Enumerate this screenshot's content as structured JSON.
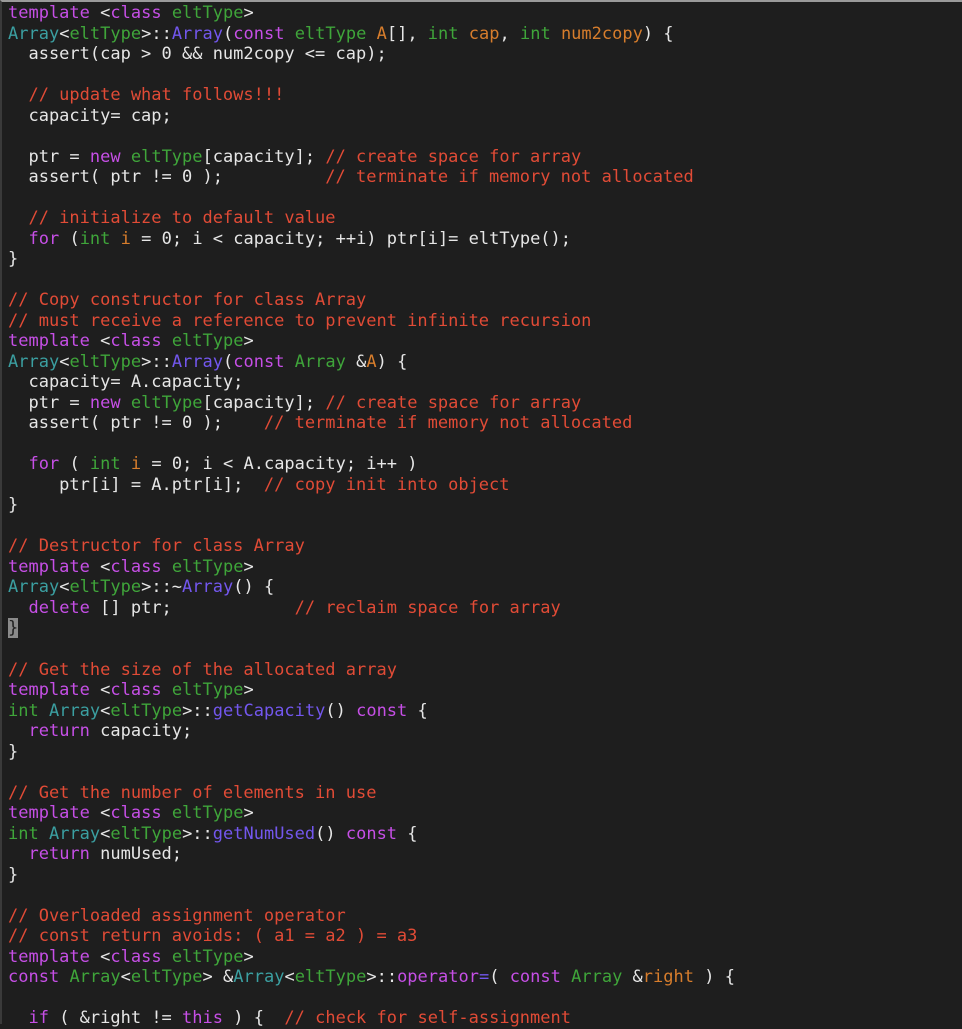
{
  "colors": {
    "background": "#1e1e1e",
    "plain": "#e6e6e6",
    "keyword": "#c64fe6",
    "type": "#3fa53a",
    "class": "#3b9fa1",
    "function": "#7357ee",
    "comment": "#e14b36",
    "parameter": "#d77d2c"
  },
  "cursor_line": 31,
  "lines": [
    [
      [
        "kw",
        "template"
      ],
      [
        "pl",
        " <"
      ],
      [
        "kw",
        "class"
      ],
      [
        "pl",
        " "
      ],
      [
        "ty",
        "eltType"
      ],
      [
        "pl",
        ">"
      ]
    ],
    [
      [
        "cls",
        "Array"
      ],
      [
        "pl",
        "<"
      ],
      [
        "ty",
        "eltType"
      ],
      [
        "pl",
        ">::"
      ],
      [
        "fn",
        "Array"
      ],
      [
        "pl",
        "("
      ],
      [
        "kw",
        "const"
      ],
      [
        "pl",
        " "
      ],
      [
        "ty",
        "eltType"
      ],
      [
        "pl",
        " "
      ],
      [
        "par",
        "A"
      ],
      [
        "pl",
        "[], "
      ],
      [
        "ty",
        "int"
      ],
      [
        "pl",
        " "
      ],
      [
        "par",
        "cap"
      ],
      [
        "pl",
        ", "
      ],
      [
        "ty",
        "int"
      ],
      [
        "pl",
        " "
      ],
      [
        "par",
        "num2copy"
      ],
      [
        "pl",
        ") {"
      ]
    ],
    [
      [
        "pl",
        "  assert(cap > 0 && num2copy <= cap);"
      ]
    ],
    [],
    [
      [
        "cm",
        "  // update what follows!!!"
      ]
    ],
    [
      [
        "pl",
        "  capacity= cap;"
      ]
    ],
    [],
    [
      [
        "pl",
        "  ptr = "
      ],
      [
        "kw",
        "new"
      ],
      [
        "pl",
        " "
      ],
      [
        "ty",
        "eltType"
      ],
      [
        "pl",
        "[capacity]; "
      ],
      [
        "cm",
        "// create space for array"
      ]
    ],
    [
      [
        "pl",
        "  assert( ptr != 0 );          "
      ],
      [
        "cm",
        "// terminate if memory not allocated"
      ]
    ],
    [],
    [
      [
        "cm",
        "  // initialize to default value"
      ]
    ],
    [
      [
        "pl",
        "  "
      ],
      [
        "kw",
        "for"
      ],
      [
        "pl",
        " ("
      ],
      [
        "ty",
        "int"
      ],
      [
        "pl",
        " "
      ],
      [
        "par",
        "i"
      ],
      [
        "pl",
        " = 0; i < capacity; ++i) ptr[i]= eltType();"
      ]
    ],
    [
      [
        "pl",
        "}"
      ]
    ],
    [],
    [
      [
        "cm",
        "// Copy constructor for class Array"
      ]
    ],
    [
      [
        "cm",
        "// must receive a reference to prevent infinite recursion"
      ]
    ],
    [
      [
        "kw",
        "template"
      ],
      [
        "pl",
        " <"
      ],
      [
        "kw",
        "class"
      ],
      [
        "pl",
        " "
      ],
      [
        "ty",
        "eltType"
      ],
      [
        "pl",
        ">"
      ]
    ],
    [
      [
        "cls",
        "Array"
      ],
      [
        "pl",
        "<"
      ],
      [
        "ty",
        "eltType"
      ],
      [
        "pl",
        ">::"
      ],
      [
        "fn",
        "Array"
      ],
      [
        "pl",
        "("
      ],
      [
        "kw",
        "const"
      ],
      [
        "pl",
        " "
      ],
      [
        "ty",
        "Array"
      ],
      [
        "pl",
        " &"
      ],
      [
        "par",
        "A"
      ],
      [
        "pl",
        ") {"
      ]
    ],
    [
      [
        "pl",
        "  capacity= A.capacity;"
      ]
    ],
    [
      [
        "pl",
        "  ptr = "
      ],
      [
        "kw",
        "new"
      ],
      [
        "pl",
        " "
      ],
      [
        "ty",
        "eltType"
      ],
      [
        "pl",
        "[capacity]; "
      ],
      [
        "cm",
        "// create space for array"
      ]
    ],
    [
      [
        "pl",
        "  assert( ptr != 0 );    "
      ],
      [
        "cm",
        "// terminate if memory not allocated"
      ]
    ],
    [],
    [
      [
        "pl",
        "  "
      ],
      [
        "kw",
        "for"
      ],
      [
        "pl",
        " ( "
      ],
      [
        "ty",
        "int"
      ],
      [
        "pl",
        " "
      ],
      [
        "par",
        "i"
      ],
      [
        "pl",
        " = 0; i < A.capacity; i++ )"
      ]
    ],
    [
      [
        "pl",
        "     ptr[i] = A.ptr[i];  "
      ],
      [
        "cm",
        "// copy init into object"
      ]
    ],
    [
      [
        "pl",
        "}"
      ]
    ],
    [],
    [
      [
        "cm",
        "// Destructor for class Array"
      ]
    ],
    [
      [
        "kw",
        "template"
      ],
      [
        "pl",
        " <"
      ],
      [
        "kw",
        "class"
      ],
      [
        "pl",
        " "
      ],
      [
        "ty",
        "eltType"
      ],
      [
        "pl",
        ">"
      ]
    ],
    [
      [
        "cls",
        "Array"
      ],
      [
        "pl",
        "<"
      ],
      [
        "ty",
        "eltType"
      ],
      [
        "pl",
        ">::~"
      ],
      [
        "fn",
        "Array"
      ],
      [
        "pl",
        "() {"
      ]
    ],
    [
      [
        "pl",
        "  "
      ],
      [
        "kw",
        "delete"
      ],
      [
        "pl",
        " [] ptr;            "
      ],
      [
        "cm",
        "// reclaim space for array"
      ]
    ],
    [
      [
        "pl",
        "}"
      ]
    ],
    [],
    [
      [
        "cm",
        "// Get the size of the allocated array"
      ]
    ],
    [
      [
        "kw",
        "template"
      ],
      [
        "pl",
        " <"
      ],
      [
        "kw",
        "class"
      ],
      [
        "pl",
        " "
      ],
      [
        "ty",
        "eltType"
      ],
      [
        "pl",
        ">"
      ]
    ],
    [
      [
        "ty",
        "int"
      ],
      [
        "pl",
        " "
      ],
      [
        "cls",
        "Array"
      ],
      [
        "pl",
        "<"
      ],
      [
        "ty",
        "eltType"
      ],
      [
        "pl",
        ">::"
      ],
      [
        "fn",
        "getCapacity"
      ],
      [
        "pl",
        "() "
      ],
      [
        "kw",
        "const"
      ],
      [
        "pl",
        " {"
      ]
    ],
    [
      [
        "pl",
        "  "
      ],
      [
        "kw",
        "return"
      ],
      [
        "pl",
        " capacity;"
      ]
    ],
    [
      [
        "pl",
        "}"
      ]
    ],
    [],
    [
      [
        "cm",
        "// Get the number of elements in use"
      ]
    ],
    [
      [
        "kw",
        "template"
      ],
      [
        "pl",
        " <"
      ],
      [
        "kw",
        "class"
      ],
      [
        "pl",
        " "
      ],
      [
        "ty",
        "eltType"
      ],
      [
        "pl",
        ">"
      ]
    ],
    [
      [
        "ty",
        "int"
      ],
      [
        "pl",
        " "
      ],
      [
        "cls",
        "Array"
      ],
      [
        "pl",
        "<"
      ],
      [
        "ty",
        "eltType"
      ],
      [
        "pl",
        ">::"
      ],
      [
        "fn",
        "getNumUsed"
      ],
      [
        "pl",
        "() "
      ],
      [
        "kw",
        "const"
      ],
      [
        "pl",
        " {"
      ]
    ],
    [
      [
        "pl",
        "  "
      ],
      [
        "kw",
        "return"
      ],
      [
        "pl",
        " numUsed;"
      ]
    ],
    [
      [
        "pl",
        "}"
      ]
    ],
    [],
    [
      [
        "cm",
        "// Overloaded assignment operator"
      ]
    ],
    [
      [
        "cm",
        "// const return avoids: ( a1 = a2 ) = a3"
      ]
    ],
    [
      [
        "kw",
        "template"
      ],
      [
        "pl",
        " <"
      ],
      [
        "kw",
        "class"
      ],
      [
        "pl",
        " "
      ],
      [
        "ty",
        "eltType"
      ],
      [
        "pl",
        ">"
      ]
    ],
    [
      [
        "kw",
        "const"
      ],
      [
        "pl",
        " "
      ],
      [
        "ty",
        "Array"
      ],
      [
        "pl",
        "<"
      ],
      [
        "ty",
        "eltType"
      ],
      [
        "pl",
        "> &"
      ],
      [
        "cls",
        "Array"
      ],
      [
        "pl",
        "<"
      ],
      [
        "ty",
        "eltType"
      ],
      [
        "pl",
        ">::"
      ],
      [
        "kw",
        "operator"
      ],
      [
        "fn",
        "="
      ],
      [
        "pl",
        "( "
      ],
      [
        "kw",
        "const"
      ],
      [
        "pl",
        " "
      ],
      [
        "ty",
        "Array"
      ],
      [
        "pl",
        " &"
      ],
      [
        "par",
        "right"
      ],
      [
        "pl",
        " ) {"
      ]
    ],
    [],
    [
      [
        "pl",
        "  "
      ],
      [
        "kw",
        "if"
      ],
      [
        "pl",
        " ( &right != "
      ],
      [
        "kw",
        "this"
      ],
      [
        "pl",
        " ) {  "
      ],
      [
        "cm",
        "// check for self-assignment"
      ]
    ]
  ]
}
